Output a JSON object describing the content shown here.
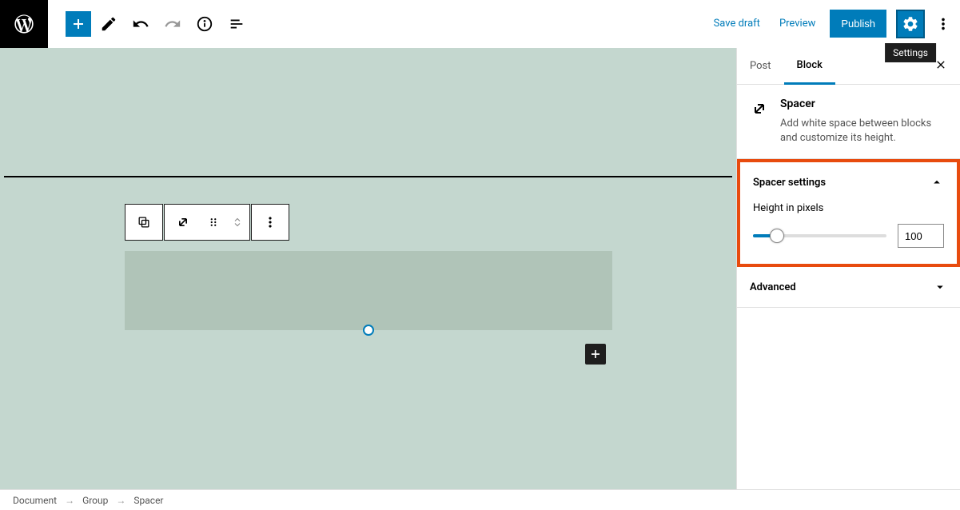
{
  "toolbar": {
    "save_draft": "Save draft",
    "preview": "Preview",
    "publish": "Publish",
    "settings_tooltip": "Settings"
  },
  "sidebar": {
    "tabs": {
      "post": "Post",
      "block": "Block"
    },
    "block_name": "Spacer",
    "block_desc": "Add white space between blocks and customize its height.",
    "panel1": {
      "title": "Spacer settings",
      "field_label": "Height in pixels",
      "value": "100"
    },
    "panel2": {
      "title": "Advanced"
    }
  },
  "breadcrumb": {
    "items": [
      "Document",
      "Group",
      "Spacer"
    ],
    "sep": "→"
  }
}
